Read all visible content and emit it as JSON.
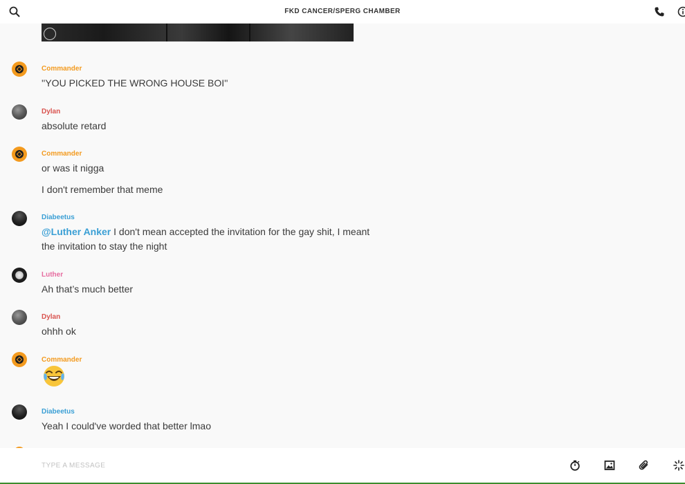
{
  "header": {
    "title": "FKD CANCER/SPERG CHAMBER",
    "search_icon": "search-icon",
    "call_icon": "phone-icon",
    "info_icon": "info-icon"
  },
  "messages": [
    {
      "user": "Commander",
      "avatar": "commander-avatar",
      "lines": [
        "''YOU PICKED THE WRONG HOUSE BOI''"
      ]
    },
    {
      "user": "Dylan",
      "avatar": "dylan-avatar",
      "lines": [
        "absolute retard"
      ]
    },
    {
      "user": "Commander",
      "avatar": "commander-avatar",
      "lines": [
        "or was it nigga",
        "I don't remember that meme"
      ]
    },
    {
      "user": "Diabeetus",
      "avatar": "diabeetus-avatar",
      "mention": "@Luther Anker",
      "lines": [
        "I don't mean accepted the invitation for the gay shit, I meant",
        "the invitation to stay the night"
      ]
    },
    {
      "user": "Luther",
      "avatar": "luther-avatar",
      "lines": [
        "Ah that’s much better"
      ]
    },
    {
      "user": "Dylan",
      "avatar": "dylan-avatar",
      "lines": [
        "ohhh ok"
      ]
    },
    {
      "user": "Commander",
      "avatar": "commander-avatar",
      "emoji": "😂"
    },
    {
      "user": "Diabeetus",
      "avatar": "diabeetus-avatar",
      "lines": [
        "Yeah I could've worded that better lmao"
      ]
    }
  ],
  "colors": {
    "commander": "#f39a1e",
    "dylan": "#d9534f",
    "diabeetus": "#3a9fd5",
    "luther": "#e66da0"
  },
  "composer": {
    "placeholder": "TYPE A MESSAGE",
    "icons": [
      "timer-icon",
      "image-icon",
      "paperclip-icon",
      "sparkle-icon"
    ]
  }
}
